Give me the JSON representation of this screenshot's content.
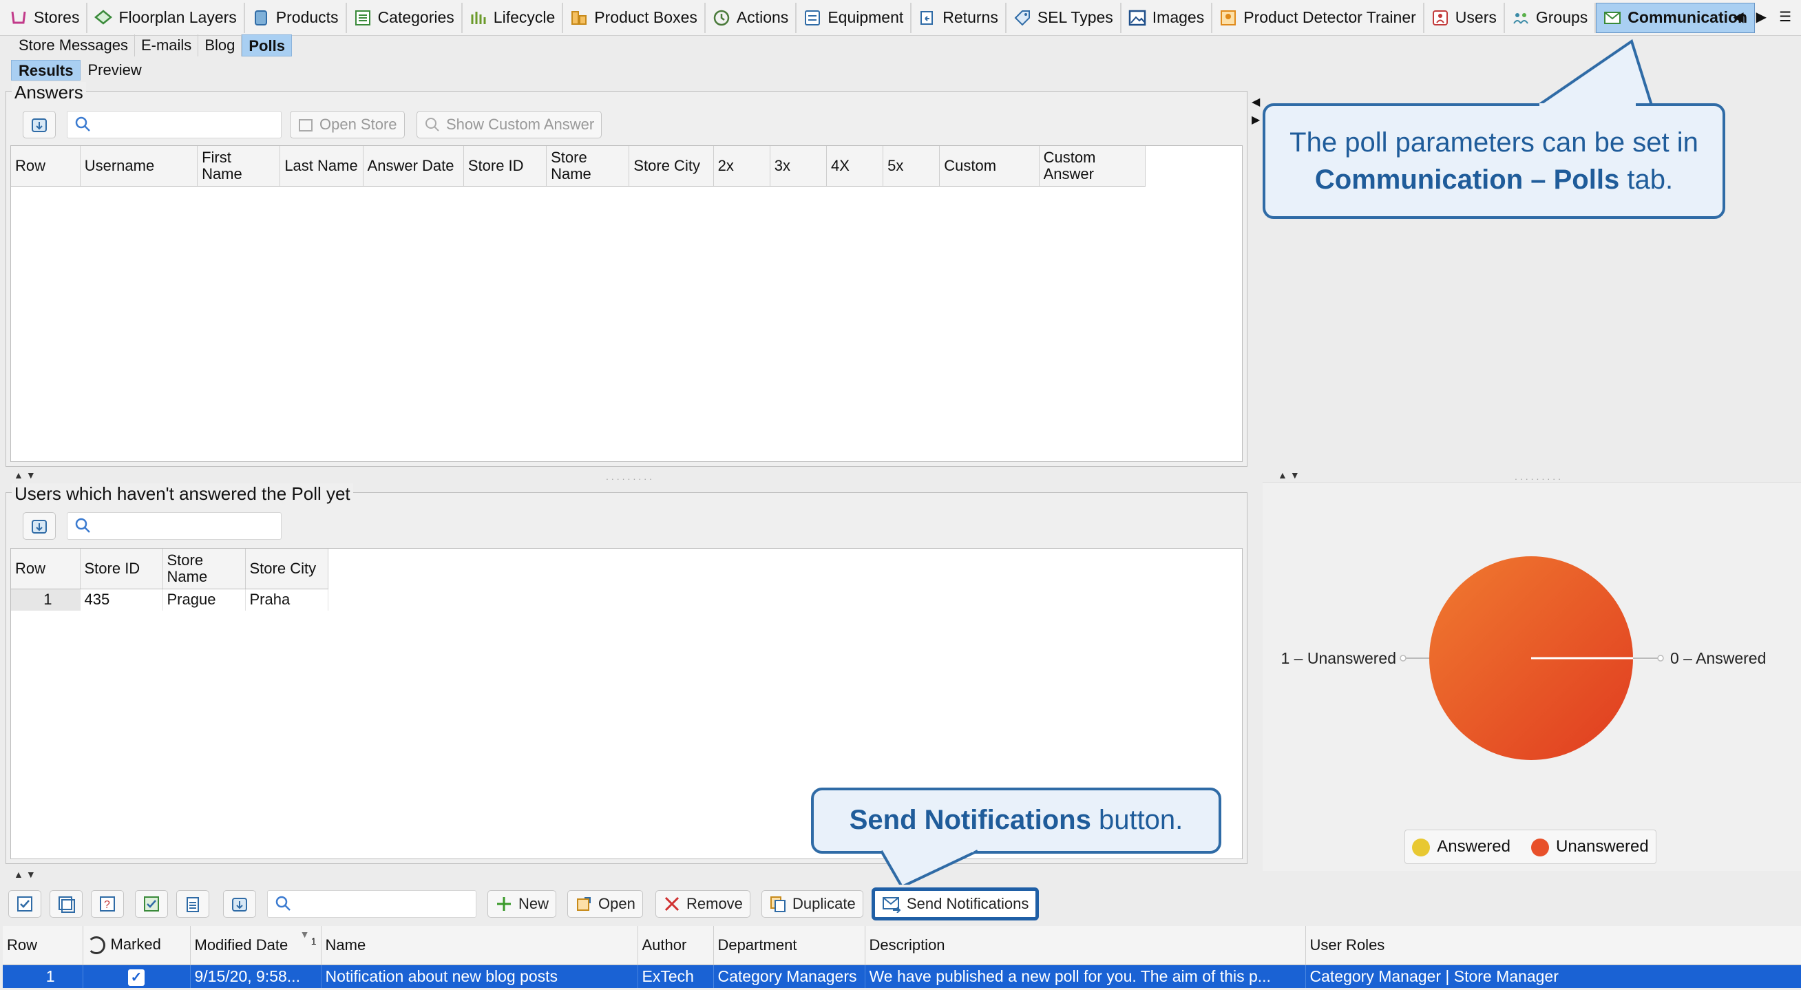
{
  "module_tabs": [
    {
      "label": "Stores",
      "icon": "cart-icon"
    },
    {
      "label": "Floorplan Layers",
      "icon": "layers-icon"
    },
    {
      "label": "Products",
      "icon": "product-icon"
    },
    {
      "label": "Categories",
      "icon": "list-icon"
    },
    {
      "label": "Lifecycle",
      "icon": "lifecycle-icon"
    },
    {
      "label": "Product Boxes",
      "icon": "boxes-icon"
    },
    {
      "label": "Actions",
      "icon": "clock-icon"
    },
    {
      "label": "Equipment",
      "icon": "equipment-icon"
    },
    {
      "label": "Returns",
      "icon": "returns-icon"
    },
    {
      "label": "SEL Types",
      "icon": "tag-icon"
    },
    {
      "label": "Images",
      "icon": "image-icon"
    },
    {
      "label": "Product Detector Trainer",
      "icon": "trainer-icon"
    },
    {
      "label": "Users",
      "icon": "user-icon"
    },
    {
      "label": "Groups",
      "icon": "groups-icon"
    },
    {
      "label": "Communication",
      "icon": "envelope-icon",
      "active": true
    }
  ],
  "sub_tabs": [
    "Store Messages",
    "E-mails",
    "Blog",
    "Polls"
  ],
  "active_sub_tab": "Polls",
  "view_tabs": [
    "Results",
    "Preview"
  ],
  "answers": {
    "title": "Answers",
    "open_store_label": "Open Store",
    "show_custom_answer_label": "Show Custom Answer",
    "search_placeholder": "",
    "columns": [
      "Row",
      "Username",
      "First Name",
      "Last Name",
      "Answer Date",
      "Store ID",
      "Store Name",
      "Store City",
      "2x",
      "3x",
      "4X",
      "5x",
      "Custom",
      "Custom Answer"
    ]
  },
  "unanswered": {
    "title": "Users which haven't answered the Poll yet",
    "search_placeholder": "",
    "columns": [
      "Row",
      "Store ID",
      "Store Name",
      "Store City"
    ],
    "rows": [
      [
        "1",
        "435",
        "Prague",
        "Praha"
      ]
    ]
  },
  "chart_data": {
    "type": "pie",
    "categories": [
      "Answered",
      "Unanswered"
    ],
    "values": [
      0,
      1
    ],
    "slice_labels": [
      "0 – Answered",
      "1 – Unanswered"
    ],
    "legend": [
      "Answered",
      "Unanswered"
    ],
    "legend_position": "bottom",
    "colors": {
      "Answered": "#e8c832",
      "Unanswered": "#e8502a"
    }
  },
  "callouts": {
    "polls_tab_pre": "The poll parameters can be set in ",
    "polls_tab_bold": "Communication – Polls",
    "polls_tab_post": " tab.",
    "send_bold": "Send Notifications",
    "send_post": " button."
  },
  "bottom_toolbar": {
    "new_label": "New",
    "open_label": "Open",
    "remove_label": "Remove",
    "duplicate_label": "Duplicate",
    "send_notifications_label": "Send Notifications"
  },
  "polls_table": {
    "columns": [
      "Row",
      "Marked",
      "Modified Date",
      "Name",
      "Author",
      "Department",
      "Description",
      "User Roles"
    ],
    "sort_indicator": "1",
    "rows": [
      [
        "1",
        "✓",
        "9/15/20, 9:58...",
        "Notification about new blog posts",
        "ExTech",
        "Category Managers",
        "We have published a new poll for you. The aim of this p...",
        "Category Manager | Store Manager"
      ]
    ]
  },
  "colors": {
    "accent": "#a9cff2",
    "selected_row": "#1a62d4",
    "callout_border": "#2f6ba6",
    "callout_text": "#1f5c9a"
  }
}
